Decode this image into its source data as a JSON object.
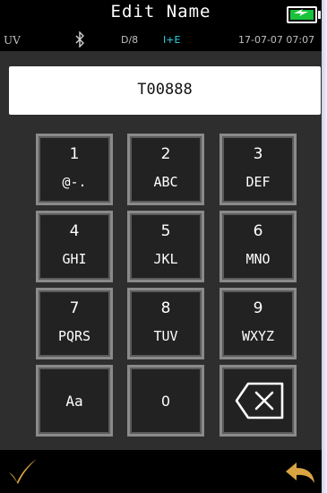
{
  "header": {
    "title": "Edit Name"
  },
  "status": {
    "source": "UV",
    "geometry": "D/8",
    "mode": "I+E",
    "datetime": "17-07-07 07:07"
  },
  "name_field": {
    "value": "T00888"
  },
  "keypad": {
    "keys": [
      {
        "num": "1",
        "sub": "@-."
      },
      {
        "num": "2",
        "sub": "ABC"
      },
      {
        "num": "3",
        "sub": "DEF"
      },
      {
        "num": "4",
        "sub": "GHI"
      },
      {
        "num": "5",
        "sub": "JKL"
      },
      {
        "num": "6",
        "sub": "MNO"
      },
      {
        "num": "7",
        "sub": "PQRS"
      },
      {
        "num": "8",
        "sub": "TUV"
      },
      {
        "num": "9",
        "sub": "WXYZ"
      }
    ],
    "case_toggle": "Aa",
    "zero": "0"
  },
  "icons": {
    "battery": "battery-charging-icon",
    "bluetooth": "bluetooth-icon",
    "backspace": "backspace-icon",
    "confirm": "checkmark-icon",
    "back": "back-arrow-icon"
  },
  "colors": {
    "accent": "#D9A441",
    "mode_text": "#2FD3E8",
    "battery": "#19C23A"
  }
}
